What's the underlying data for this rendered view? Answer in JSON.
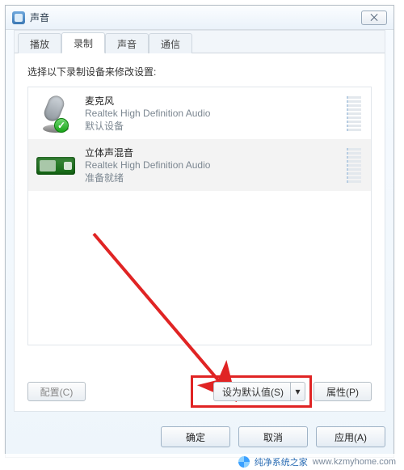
{
  "window": {
    "title": "声音",
    "close_glyph": "⨉"
  },
  "tabs": [
    {
      "label": "播放"
    },
    {
      "label": "录制"
    },
    {
      "label": "声音"
    },
    {
      "label": "通信"
    }
  ],
  "active_tab_index": 1,
  "instruction": "选择以下录制设备来修改设置:",
  "devices": [
    {
      "title": "麦克风",
      "subtitle": "Realtek High Definition Audio",
      "status": "默认设备",
      "default": true
    },
    {
      "title": "立体声混音",
      "subtitle": "Realtek High Definition Audio",
      "status": "准备就绪",
      "default": false
    }
  ],
  "selected_device_index": 1,
  "buttons": {
    "configure": "配置(C)",
    "set_default": "设为默认值(S)",
    "properties": "属性(P)",
    "ok": "确定",
    "cancel": "取消",
    "apply": "应用(A)"
  },
  "watermark": {
    "brand": "纯净系统之家",
    "url": "www.kzmyhome.com"
  }
}
